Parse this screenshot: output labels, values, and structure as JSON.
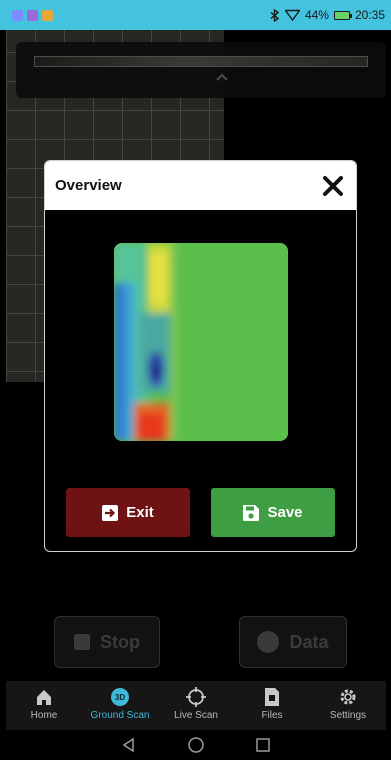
{
  "status_bar": {
    "battery_percent": "44%",
    "time": "20:35",
    "background_color": "#44c3df"
  },
  "actions": {
    "stop_label": "Stop",
    "data_label": "Data"
  },
  "bottom_nav": {
    "items": [
      {
        "label": "Home",
        "icon": "home-icon",
        "active": false
      },
      {
        "label": "Ground Scan",
        "icon": "3d-badge-icon",
        "badge": "3D",
        "active": true
      },
      {
        "label": "Live Scan",
        "icon": "crosshair-icon",
        "active": false
      },
      {
        "label": "Files",
        "icon": "file-icon",
        "active": false
      },
      {
        "label": "Settings",
        "icon": "gear-icon",
        "active": false
      }
    ],
    "active_color": "#3fb8d9"
  },
  "modal": {
    "title": "Overview",
    "exit_label": "Exit",
    "save_label": "Save",
    "exit_color": "#6e1214",
    "save_color": "#3f9d44"
  }
}
